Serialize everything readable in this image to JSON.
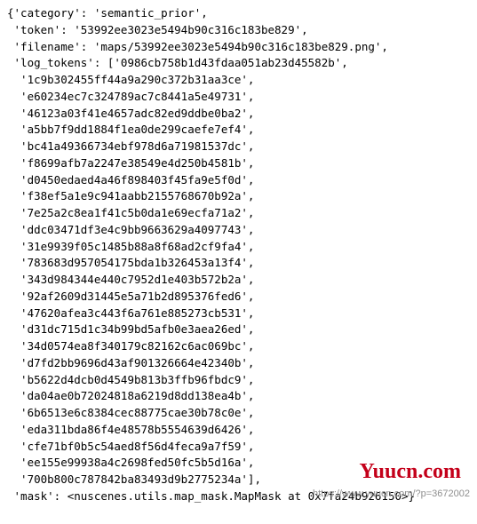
{
  "header": {
    "category_line": "{'category': 'semantic_prior',",
    "token_line": " 'token': '53992ee3023e5494b90c316c183be829',",
    "filename_line": " 'filename': 'maps/53992ee3023e5494b90c316c183be829.png',",
    "log_tokens_intro": " 'log_tokens': ['0986cb758b1d43fdaa051ab23d45582b',"
  },
  "log_tokens": [
    "1c9b302455ff44a9a290c372b31aa3ce",
    "e60234ec7c324789ac7c8441a5e49731",
    "46123a03f41e4657adc82ed9ddbe0ba2",
    "a5bb7f9dd1884f1ea0de299caefe7ef4",
    "bc41a49366734ebf978d6a71981537dc",
    "f8699afb7a2247e38549e4d250b4581b",
    "d0450edaed4a46f898403f45fa9e5f0d",
    "f38ef5a1e9c941aabb2155768670b92a",
    "7e25a2c8ea1f41c5b0da1e69ecfa71a2",
    "ddc03471df3e4c9bb9663629a4097743",
    "31e9939f05c1485b88a8f68ad2cf9fa4",
    "783683d957054175bda1b326453a13f4",
    "343d984344e440c7952d1e403b572b2a",
    "92af2609d31445e5a71b2d895376fed6",
    "47620afea3c443f6a761e885273cb531",
    "d31dc715d1c34b99bd5afb0e3aea26ed",
    "34d0574ea8f340179c82162c6ac069bc",
    "d7fd2bb9696d43af901326664e42340b",
    "b5622d4dcb0d4549b813b3ffb96fbdc9",
    "da04ae0b72024818a6219d8dd138ea4b",
    "6b6513e6c8384cec88775cae30b78c0e",
    "eda311bda86f4e48578b5554639d6426",
    "cfe71bf0b5c54aed8f56d4feca9a7f59",
    "ee155e99938a4c2698fed50fc5b5d16a"
  ],
  "log_tokens_last": "700b800c787842ba83493d9b2775234a",
  "footer": {
    "mask_line": " 'mask': <nuscenes.utils.map_mask.MapMask at 0x7fa24b926150>}"
  },
  "watermarks": {
    "red": "Yuucn.com",
    "gray": "https://www.yuucn.com/?p=3672002"
  }
}
